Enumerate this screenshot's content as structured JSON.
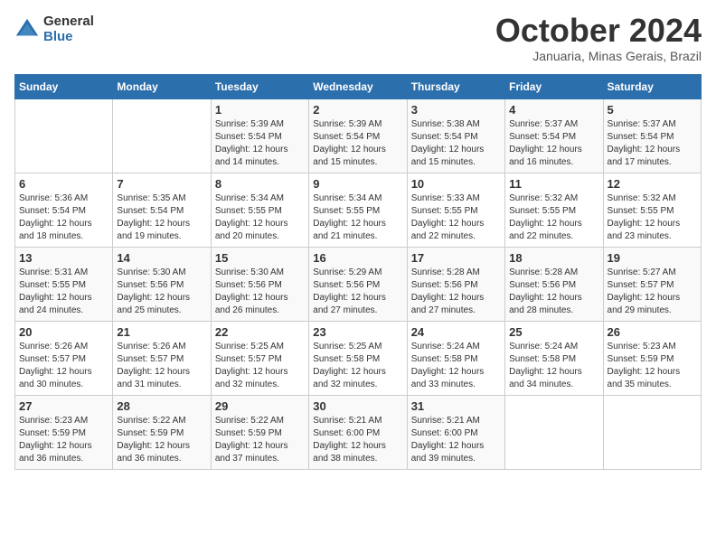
{
  "logo": {
    "general": "General",
    "blue": "Blue"
  },
  "title": "October 2024",
  "subtitle": "Januaria, Minas Gerais, Brazil",
  "days_of_week": [
    "Sunday",
    "Monday",
    "Tuesday",
    "Wednesday",
    "Thursday",
    "Friday",
    "Saturday"
  ],
  "weeks": [
    [
      {
        "day": "",
        "sunrise": "",
        "sunset": "",
        "daylight": ""
      },
      {
        "day": "",
        "sunrise": "",
        "sunset": "",
        "daylight": ""
      },
      {
        "day": "1",
        "sunrise": "Sunrise: 5:39 AM",
        "sunset": "Sunset: 5:54 PM",
        "daylight": "Daylight: 12 hours and 14 minutes."
      },
      {
        "day": "2",
        "sunrise": "Sunrise: 5:39 AM",
        "sunset": "Sunset: 5:54 PM",
        "daylight": "Daylight: 12 hours and 15 minutes."
      },
      {
        "day": "3",
        "sunrise": "Sunrise: 5:38 AM",
        "sunset": "Sunset: 5:54 PM",
        "daylight": "Daylight: 12 hours and 15 minutes."
      },
      {
        "day": "4",
        "sunrise": "Sunrise: 5:37 AM",
        "sunset": "Sunset: 5:54 PM",
        "daylight": "Daylight: 12 hours and 16 minutes."
      },
      {
        "day": "5",
        "sunrise": "Sunrise: 5:37 AM",
        "sunset": "Sunset: 5:54 PM",
        "daylight": "Daylight: 12 hours and 17 minutes."
      }
    ],
    [
      {
        "day": "6",
        "sunrise": "Sunrise: 5:36 AM",
        "sunset": "Sunset: 5:54 PM",
        "daylight": "Daylight: 12 hours and 18 minutes."
      },
      {
        "day": "7",
        "sunrise": "Sunrise: 5:35 AM",
        "sunset": "Sunset: 5:54 PM",
        "daylight": "Daylight: 12 hours and 19 minutes."
      },
      {
        "day": "8",
        "sunrise": "Sunrise: 5:34 AM",
        "sunset": "Sunset: 5:55 PM",
        "daylight": "Daylight: 12 hours and 20 minutes."
      },
      {
        "day": "9",
        "sunrise": "Sunrise: 5:34 AM",
        "sunset": "Sunset: 5:55 PM",
        "daylight": "Daylight: 12 hours and 21 minutes."
      },
      {
        "day": "10",
        "sunrise": "Sunrise: 5:33 AM",
        "sunset": "Sunset: 5:55 PM",
        "daylight": "Daylight: 12 hours and 22 minutes."
      },
      {
        "day": "11",
        "sunrise": "Sunrise: 5:32 AM",
        "sunset": "Sunset: 5:55 PM",
        "daylight": "Daylight: 12 hours and 22 minutes."
      },
      {
        "day": "12",
        "sunrise": "Sunrise: 5:32 AM",
        "sunset": "Sunset: 5:55 PM",
        "daylight": "Daylight: 12 hours and 23 minutes."
      }
    ],
    [
      {
        "day": "13",
        "sunrise": "Sunrise: 5:31 AM",
        "sunset": "Sunset: 5:55 PM",
        "daylight": "Daylight: 12 hours and 24 minutes."
      },
      {
        "day": "14",
        "sunrise": "Sunrise: 5:30 AM",
        "sunset": "Sunset: 5:56 PM",
        "daylight": "Daylight: 12 hours and 25 minutes."
      },
      {
        "day": "15",
        "sunrise": "Sunrise: 5:30 AM",
        "sunset": "Sunset: 5:56 PM",
        "daylight": "Daylight: 12 hours and 26 minutes."
      },
      {
        "day": "16",
        "sunrise": "Sunrise: 5:29 AM",
        "sunset": "Sunset: 5:56 PM",
        "daylight": "Daylight: 12 hours and 27 minutes."
      },
      {
        "day": "17",
        "sunrise": "Sunrise: 5:28 AM",
        "sunset": "Sunset: 5:56 PM",
        "daylight": "Daylight: 12 hours and 27 minutes."
      },
      {
        "day": "18",
        "sunrise": "Sunrise: 5:28 AM",
        "sunset": "Sunset: 5:56 PM",
        "daylight": "Daylight: 12 hours and 28 minutes."
      },
      {
        "day": "19",
        "sunrise": "Sunrise: 5:27 AM",
        "sunset": "Sunset: 5:57 PM",
        "daylight": "Daylight: 12 hours and 29 minutes."
      }
    ],
    [
      {
        "day": "20",
        "sunrise": "Sunrise: 5:26 AM",
        "sunset": "Sunset: 5:57 PM",
        "daylight": "Daylight: 12 hours and 30 minutes."
      },
      {
        "day": "21",
        "sunrise": "Sunrise: 5:26 AM",
        "sunset": "Sunset: 5:57 PM",
        "daylight": "Daylight: 12 hours and 31 minutes."
      },
      {
        "day": "22",
        "sunrise": "Sunrise: 5:25 AM",
        "sunset": "Sunset: 5:57 PM",
        "daylight": "Daylight: 12 hours and 32 minutes."
      },
      {
        "day": "23",
        "sunrise": "Sunrise: 5:25 AM",
        "sunset": "Sunset: 5:58 PM",
        "daylight": "Daylight: 12 hours and 32 minutes."
      },
      {
        "day": "24",
        "sunrise": "Sunrise: 5:24 AM",
        "sunset": "Sunset: 5:58 PM",
        "daylight": "Daylight: 12 hours and 33 minutes."
      },
      {
        "day": "25",
        "sunrise": "Sunrise: 5:24 AM",
        "sunset": "Sunset: 5:58 PM",
        "daylight": "Daylight: 12 hours and 34 minutes."
      },
      {
        "day": "26",
        "sunrise": "Sunrise: 5:23 AM",
        "sunset": "Sunset: 5:59 PM",
        "daylight": "Daylight: 12 hours and 35 minutes."
      }
    ],
    [
      {
        "day": "27",
        "sunrise": "Sunrise: 5:23 AM",
        "sunset": "Sunset: 5:59 PM",
        "daylight": "Daylight: 12 hours and 36 minutes."
      },
      {
        "day": "28",
        "sunrise": "Sunrise: 5:22 AM",
        "sunset": "Sunset: 5:59 PM",
        "daylight": "Daylight: 12 hours and 36 minutes."
      },
      {
        "day": "29",
        "sunrise": "Sunrise: 5:22 AM",
        "sunset": "Sunset: 5:59 PM",
        "daylight": "Daylight: 12 hours and 37 minutes."
      },
      {
        "day": "30",
        "sunrise": "Sunrise: 5:21 AM",
        "sunset": "Sunset: 6:00 PM",
        "daylight": "Daylight: 12 hours and 38 minutes."
      },
      {
        "day": "31",
        "sunrise": "Sunrise: 5:21 AM",
        "sunset": "Sunset: 6:00 PM",
        "daylight": "Daylight: 12 hours and 39 minutes."
      },
      {
        "day": "",
        "sunrise": "",
        "sunset": "",
        "daylight": ""
      },
      {
        "day": "",
        "sunrise": "",
        "sunset": "",
        "daylight": ""
      }
    ]
  ]
}
